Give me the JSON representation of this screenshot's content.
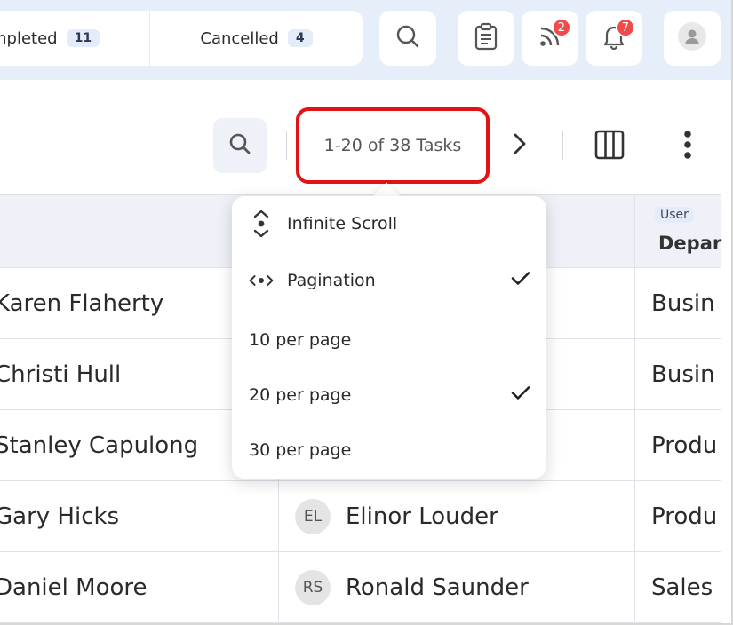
{
  "tabs": [
    {
      "label": "mpleted",
      "count": "11"
    },
    {
      "label": "Cancelled",
      "count": "4"
    }
  ],
  "topbar": {
    "feed_badge": "2",
    "bell_badge": "7"
  },
  "toolbar": {
    "pagination_label": "1-20 of 38 Tasks"
  },
  "table": {
    "dept_tag": "User",
    "dept_header": "Depar",
    "rows": [
      {
        "name": "Karen Flaherty",
        "assignee_initials": "",
        "assignee": "",
        "dept": "Busin"
      },
      {
        "name": "Christi Hull",
        "assignee_initials": "",
        "assignee": "",
        "dept": "Busin"
      },
      {
        "name": "Stanley Capulong",
        "assignee_initials": "",
        "assignee": "",
        "dept": "Produ"
      },
      {
        "name": "Gary Hicks",
        "assignee_initials": "EL",
        "assignee": "Elinor Louder",
        "dept": "Produ"
      },
      {
        "name": "Daniel Moore",
        "assignee_initials": "RS",
        "assignee": "Ronald Saunder",
        "dept": "Sales"
      }
    ]
  },
  "menu": {
    "items": [
      {
        "label": "Infinite Scroll",
        "checked": false
      },
      {
        "label": "Pagination",
        "checked": true
      },
      {
        "label": "10 per page",
        "checked": false
      },
      {
        "label": "20 per page",
        "checked": true
      },
      {
        "label": "30 per page",
        "checked": false
      }
    ]
  },
  "colors": {
    "accent_highlight": "#e01414",
    "badge_red": "#ef4b4b",
    "header_bg": "#e6eef9"
  }
}
